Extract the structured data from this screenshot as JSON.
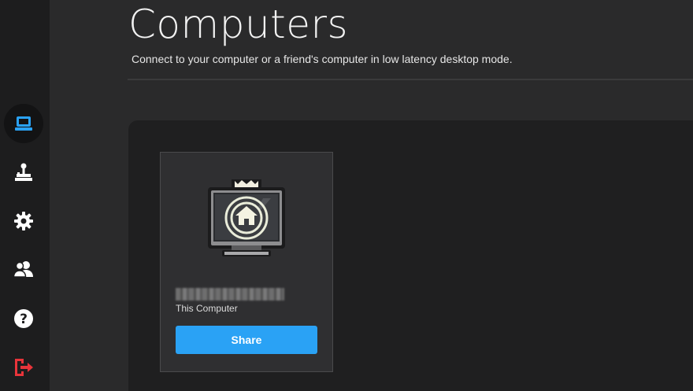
{
  "sidebar": {
    "items": [
      {
        "name": "computers",
        "icon": "laptop-icon",
        "active": true
      },
      {
        "name": "arcade",
        "icon": "joystick-icon",
        "active": false
      },
      {
        "name": "settings",
        "icon": "gear-icon",
        "active": false
      },
      {
        "name": "friends",
        "icon": "users-icon",
        "active": false
      },
      {
        "name": "help",
        "icon": "help-icon",
        "active": false
      },
      {
        "name": "logout",
        "icon": "logout-icon",
        "active": false
      }
    ]
  },
  "header": {
    "title": "Computers",
    "subtitle": "Connect to your computer or a friend's computer in low latency desktop mode."
  },
  "computers": [
    {
      "name": "DESKTOP-XXXXXXX",
      "subtitle": "This Computer",
      "action_label": "Share",
      "icon": "home-monitor-icon"
    }
  ],
  "colors": {
    "accent": "#2aa2f5",
    "active_icon": "#2aa2f5",
    "logout_icon": "#e8343a",
    "background": "#2a2a2b",
    "sidebar": "#1d1d1e"
  }
}
